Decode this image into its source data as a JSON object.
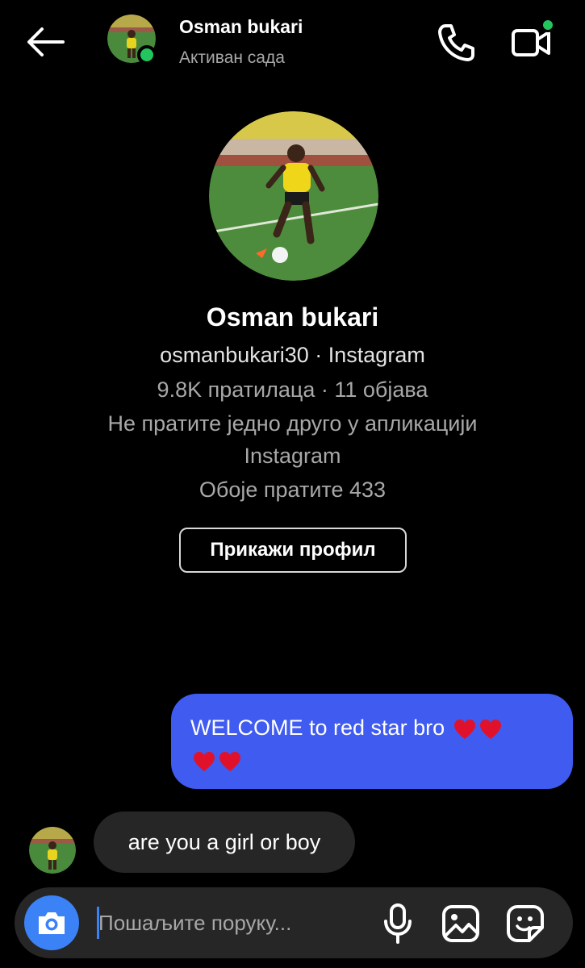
{
  "header": {
    "name": "Osman bukari",
    "status": "Активан сада",
    "back_icon": "arrow-left-icon",
    "call_icon": "phone-icon",
    "video_icon": "video-camera-icon"
  },
  "profile": {
    "name": "Osman bukari",
    "handle": "osmanbukari30 · Instagram",
    "stats": "9.8K пратилаца · 11 објава",
    "mutual_line1": "Не пратите једно друго у апликацији",
    "mutual_line2": "Instagram",
    "followed_by": "Обоје пратите 433",
    "view_profile_label": "Прикажи профил"
  },
  "messages": [
    {
      "direction": "sent",
      "text": "WELCOME to red star bro",
      "emoji": [
        "red-heart",
        "red-heart",
        "red-heart",
        "red-heart"
      ]
    },
    {
      "direction": "received",
      "text": "are you a girl or boy"
    }
  ],
  "composer": {
    "placeholder": "Пошаљите поруку...",
    "camera_icon": "camera-icon",
    "mic_icon": "microphone-icon",
    "gallery_icon": "image-icon",
    "sticker_icon": "sticker-icon"
  },
  "colors": {
    "background": "#000000",
    "sent_bubble": "#3f5bf0",
    "received_bubble": "#262626",
    "online": "#22c55e",
    "camera_button": "#3b82f6",
    "secondary_text": "#a8a8a8"
  }
}
